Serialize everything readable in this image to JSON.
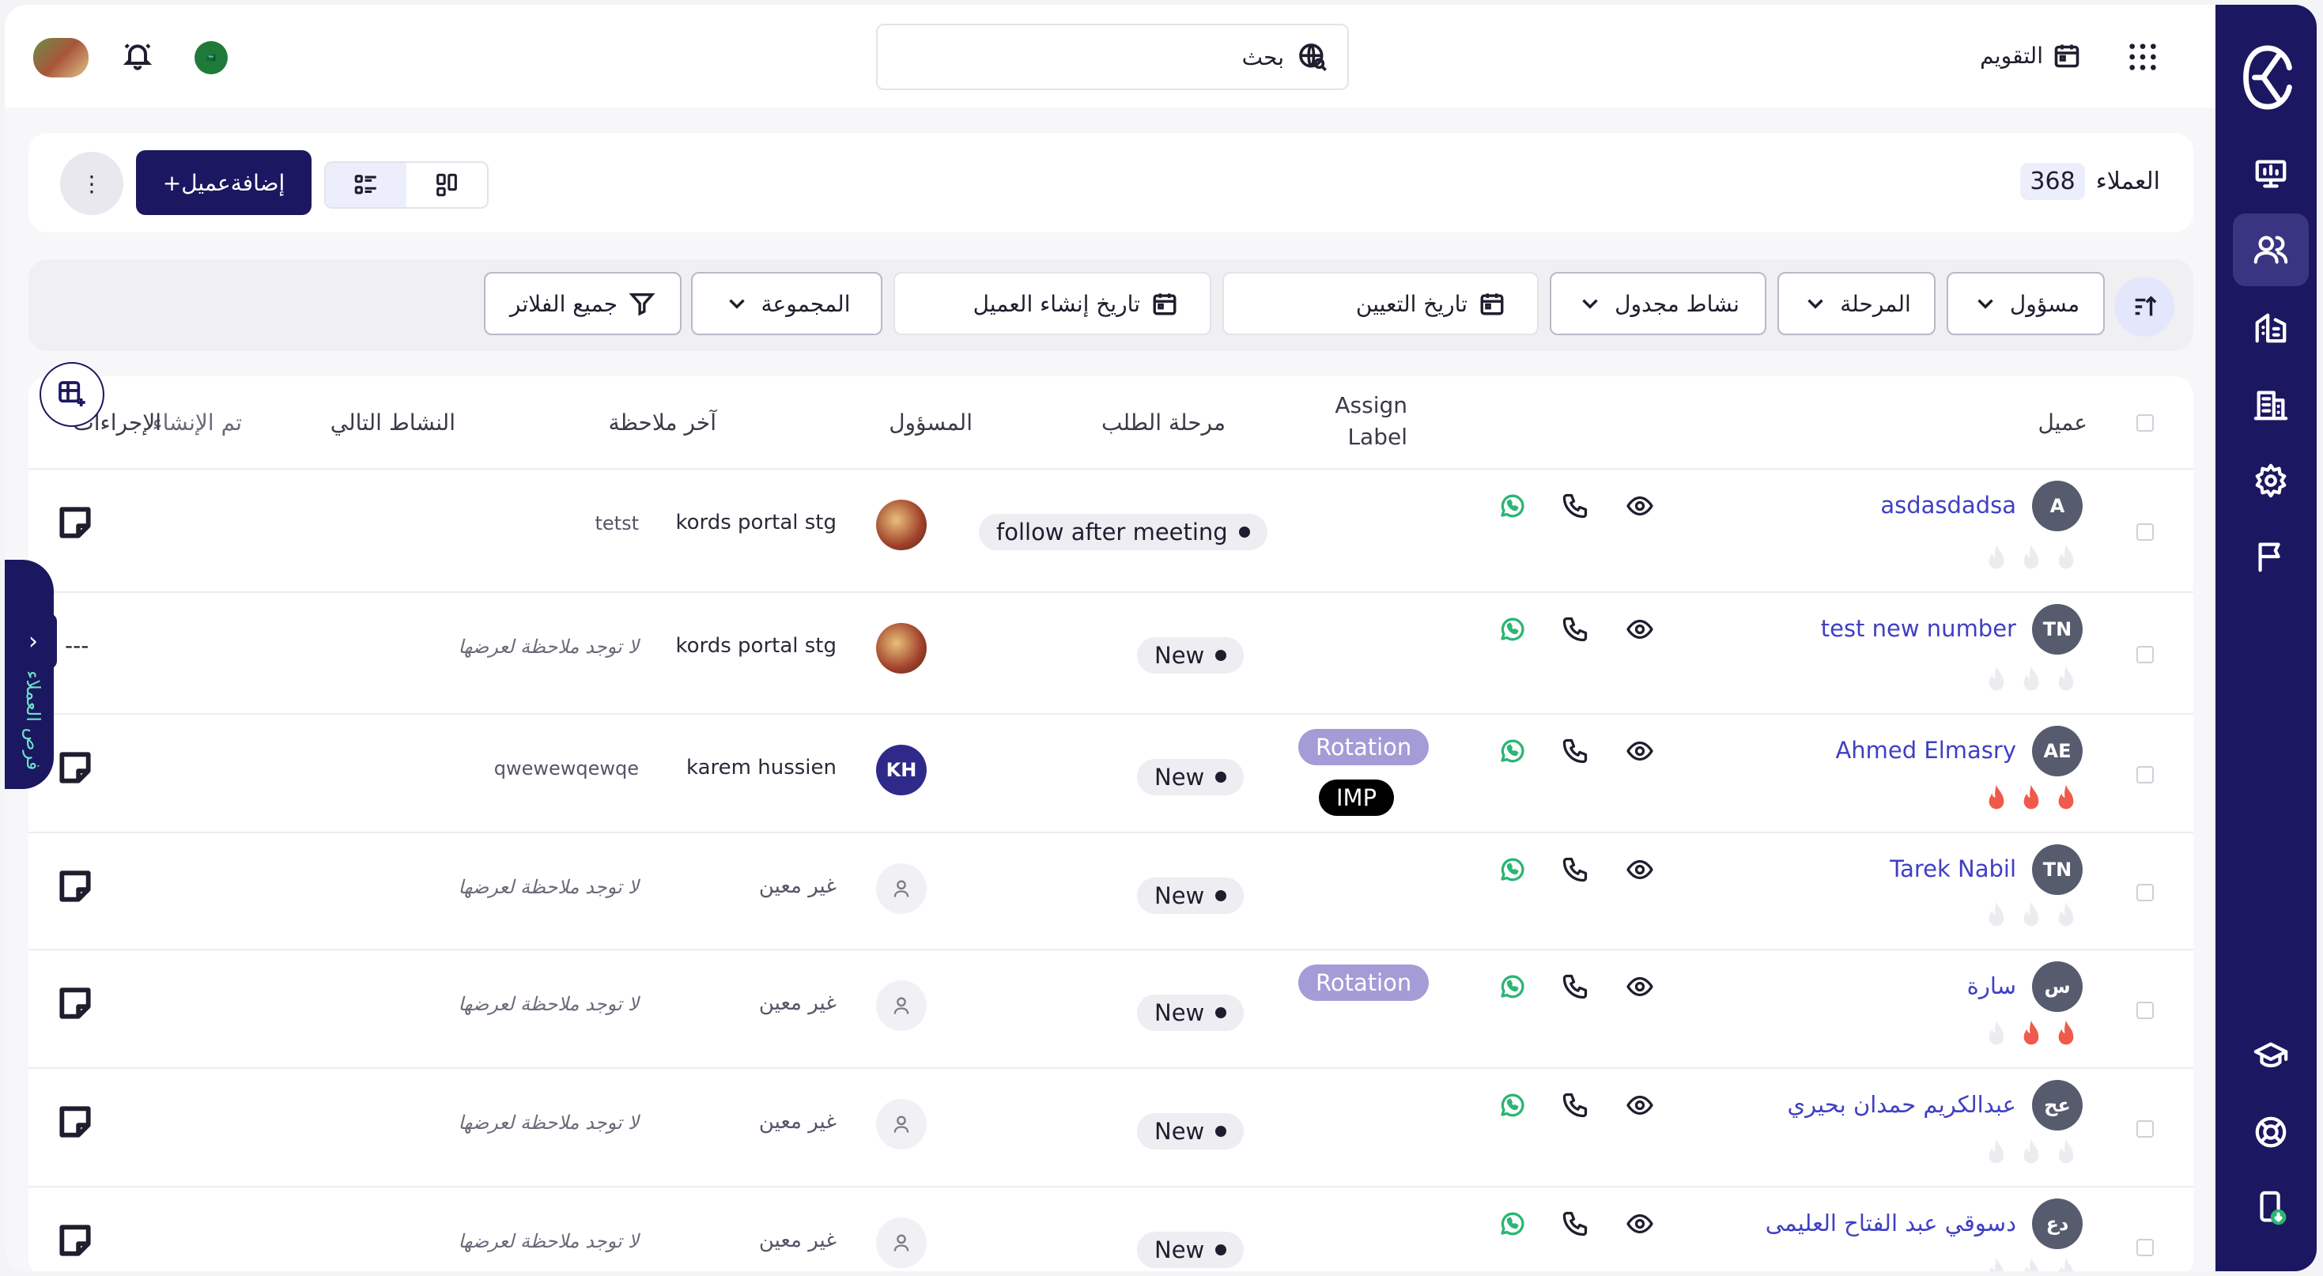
{
  "colors": {
    "brand": "#1b1760",
    "link": "#3f3fc4",
    "rotation": "#a49cd6",
    "flame_active": "#ef5a4a",
    "flame_inactive": "#ececf0"
  },
  "topbar": {
    "calendar_label": "التقويم",
    "search_placeholder": "بحث",
    "flag_text": "🇸🇦"
  },
  "header": {
    "title": "العملاء",
    "count": "368",
    "add_label": "+إضافةعميل",
    "more_label": "⋮"
  },
  "filters": {
    "owner": "مسؤول",
    "stage": "المرحلة",
    "scheduled_activity": "نشاط مجدول",
    "assign_date": "تاريخ التعيين",
    "created_date": "تاريخ إنشاء العميل",
    "group": "المجموعة",
    "all_filters": "جميع الفلاتر"
  },
  "table": {
    "headers": {
      "client": "عميل",
      "assign_label_1": "Assign",
      "assign_label_2": "Label",
      "stage": "مرحلة الطلب",
      "owner": "المسؤول",
      "last_note": "آخر ملاحظة",
      "next_activity": "النشاط التالي",
      "done": "تم الإنشاء",
      "actions": "الإجراءات"
    },
    "rows": [
      {
        "initials": "A",
        "name": "asdasdadsa",
        "flames": [
          0,
          0,
          0
        ],
        "stage": "follow after meeting",
        "labels": [],
        "owner": "kords portal stg",
        "note": "tetst",
        "next": ""
      },
      {
        "initials": "TN",
        "name": "test new number",
        "flames": [
          0,
          0,
          0
        ],
        "stage": "New",
        "labels": [],
        "owner": "kords portal stg",
        "note": "لا توجد ملاحظة لعرضها",
        "next": "---"
      },
      {
        "initials": "AE",
        "name": "Ahmed Elmasry",
        "flames": [
          1,
          1,
          1
        ],
        "stage": "New",
        "labels": [
          "Rotation",
          "IMP"
        ],
        "owner": "karem hussien",
        "owner_initials": "KH",
        "note": "qwewewqewqe",
        "next": ""
      },
      {
        "initials": "TN",
        "name": "Tarek Nabil",
        "flames": [
          0,
          0,
          0
        ],
        "stage": "New",
        "labels": [],
        "owner": "غير معين",
        "note": "لا توجد ملاحظة لعرضها",
        "next": ""
      },
      {
        "initials": "س",
        "name": "سارة",
        "flames": [
          0,
          1,
          1
        ],
        "stage": "New",
        "labels": [
          "Rotation"
        ],
        "owner": "غير معين",
        "note": "لا توجد ملاحظة لعرضها",
        "next": ""
      },
      {
        "initials": "عح",
        "name": "عبدالكريم حمدان بحيري",
        "flames": [
          0,
          0,
          0
        ],
        "stage": "New",
        "labels": [],
        "owner": "غير معين",
        "note": "لا توجد ملاحظة لعرضها",
        "next": ""
      },
      {
        "initials": "دع",
        "name": "دسوقي عبد الفتاح العليمى",
        "flames": [
          0,
          0,
          0
        ],
        "stage": "New",
        "labels": [],
        "owner": "غير معين",
        "note": "لا توجد ملاحظة لعرضها",
        "next": ""
      }
    ]
  },
  "drawer": {
    "arrow": "›",
    "vertical_text": "فرص العملاء"
  }
}
